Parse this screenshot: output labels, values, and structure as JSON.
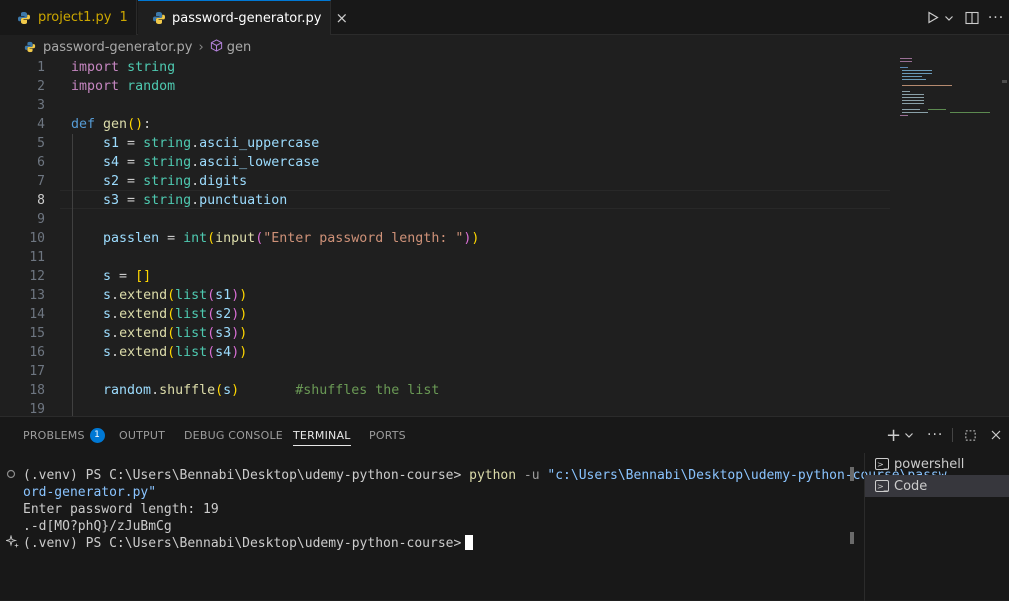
{
  "tabs": [
    {
      "label": "project1.py",
      "badge": "1"
    },
    {
      "label": "password-generator.py",
      "close": "×"
    }
  ],
  "breadcrumb": {
    "file": "password-generator.py",
    "sep": "›",
    "symbol": "gen"
  },
  "editor": {
    "line_numbers": [
      "1",
      "2",
      "3",
      "4",
      "5",
      "6",
      "7",
      "8",
      "9",
      "10",
      "11",
      "12",
      "13",
      "14",
      "15",
      "16",
      "17",
      "18",
      "19"
    ],
    "active_line": "8",
    "line1": {
      "kw": "import",
      "mod": "string"
    },
    "line2": {
      "kw": "import",
      "mod": "random"
    },
    "line4": {
      "kw": "def",
      "fn": "gen",
      "paren_open": "(",
      "paren_close": ")",
      "colon": ":"
    },
    "line5": {
      "var": "s1",
      "eq": " = ",
      "mod": "string",
      "dot": ".",
      "attr": "ascii_uppercase"
    },
    "line6": {
      "var": "s4",
      "eq": " = ",
      "mod": "string",
      "dot": ".",
      "attr": "ascii_lowercase"
    },
    "line7": {
      "var": "s2",
      "eq": " = ",
      "mod": "string",
      "dot": ".",
      "attr": "digits"
    },
    "line8": {
      "var": "s3",
      "eq": " = ",
      "mod": "string",
      "dot": ".",
      "attr": "punctuation"
    },
    "line10": {
      "var": "passlen",
      "eq": " = ",
      "fn1": "int",
      "p1": "(",
      "fn2": "input",
      "p2": "(",
      "str": "\"Enter password length: \"",
      "p3": ")",
      "p4": ")"
    },
    "line12": {
      "var": "s",
      "eq": " = ",
      "b1": "[",
      "b2": "]"
    },
    "line13": {
      "var": "s",
      "dot": ".",
      "fn": "extend",
      "p1": "(",
      "mod": "list",
      "p2": "(",
      "arg": "s1",
      "p3": ")",
      "p4": ")"
    },
    "line14": {
      "var": "s",
      "dot": ".",
      "fn": "extend",
      "p1": "(",
      "mod": "list",
      "p2": "(",
      "arg": "s2",
      "p3": ")",
      "p4": ")"
    },
    "line15": {
      "var": "s",
      "dot": ".",
      "fn": "extend",
      "p1": "(",
      "mod": "list",
      "p2": "(",
      "arg": "s3",
      "p3": ")",
      "p4": ")"
    },
    "line16": {
      "var": "s",
      "dot": ".",
      "fn": "extend",
      "p1": "(",
      "mod": "list",
      "p2": "(",
      "arg": "s4",
      "p3": ")",
      "p4": ")"
    },
    "line18": {
      "mod": "random",
      "dot": ".",
      "fn": "shuffle",
      "p1": "(",
      "arg": "s",
      "p2": ")",
      "comment": "#shuffles the list"
    }
  },
  "panel": {
    "tabs": [
      "PROBLEMS",
      "OUTPUT",
      "DEBUG CONSOLE",
      "TERMINAL",
      "PORTS"
    ],
    "problems_badge": "1",
    "add_icon": "+",
    "chevron": "⌄",
    "more": "···"
  },
  "terminal": {
    "line1_prefix": "(.venv) PS C:\\Users\\Bennabi\\Desktop\\udemy-python-course> ",
    "line1_cmd": "python",
    "line1_opt": " -u ",
    "line1_str": "\"c:\\Users\\Bennabi\\Desktop\\udemy-python-course\\passw",
    "line2_str": "ord-generator.py\"",
    "line3": "Enter password length: 19",
    "line4": ".-d[MO?phQ}/zJuBmCg",
    "line5": "(.venv) PS C:\\Users\\Bennabi\\Desktop\\udemy-python-course>"
  },
  "terminal_list": [
    {
      "label": "powershell"
    },
    {
      "label": "Code"
    }
  ],
  "colors": {
    "accent": "#0078d4",
    "warning_tab": "#cca700",
    "background": "#1f1f1f"
  }
}
